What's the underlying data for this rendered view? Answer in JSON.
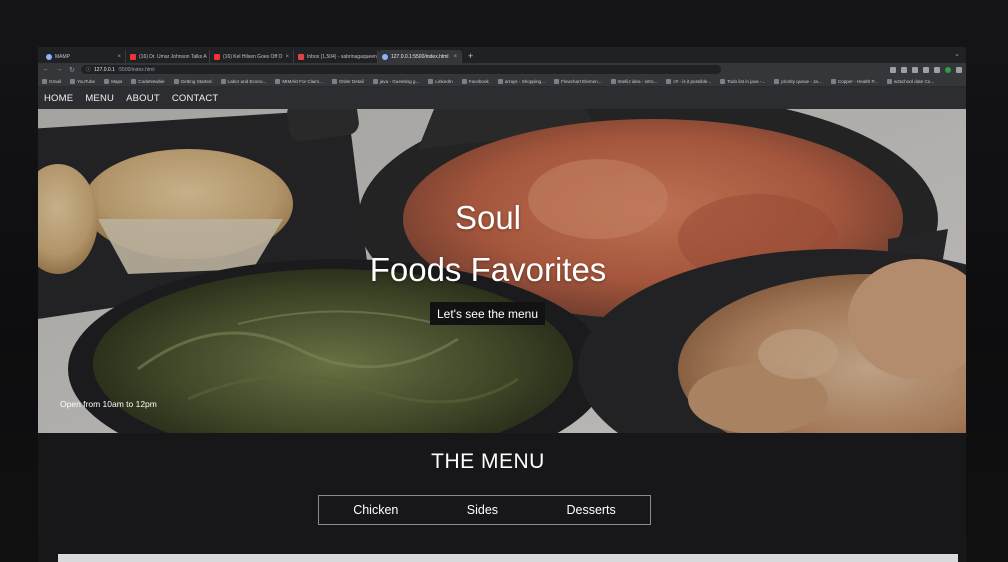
{
  "browser": {
    "tabs": [
      {
        "label": "MAMP",
        "icon": "mamp-icon",
        "active": false
      },
      {
        "label": "(16) Dr. Umar Johnson Talks A",
        "icon": "youtube-icon",
        "active": false
      },
      {
        "label": "(16) Kel Hilsen Goes Off O",
        "icon": "youtube-icon",
        "active": false
      },
      {
        "label": "Inbox (1,504) - sabrinagaqueen",
        "icon": "gmail-icon",
        "active": false
      },
      {
        "label": "127.0.0.1:5500/index.html",
        "icon": "page-icon",
        "active": true
      }
    ],
    "new_tab": "+",
    "url_host": "127.0.0.1",
    "url_path": ":5500/index.html",
    "bookmarks": [
      "Gmail",
      "YouTube",
      "Maps",
      "CodeNewbie",
      "Getting Started",
      "Labor and Econo...",
      "MIMAkt For Claim...",
      "Order Detail",
      "java - Guessing g...",
      "LinkedIn",
      "Facebook",
      "arrays - Shopping...",
      "Flowchart Elemen...",
      "IntelliJ idea - intro...",
      "c# - is it possible...",
      "Todo list in java -...",
      "priority queue - Ja...",
      "Copper - Health P...",
      "w3school date Co..."
    ]
  },
  "nav": {
    "home": "HOME",
    "menu": "MENU",
    "about": "ABOUT",
    "contact": "CONTACT"
  },
  "hero": {
    "title_line1": "Soul",
    "title_line2": "Foods Favorites",
    "cta": "Let's see the menu",
    "hours": "Open from 10am to 12pm"
  },
  "menu": {
    "title": "THE MENU",
    "tabs": [
      "Chicken",
      "Sides",
      "Desserts"
    ]
  },
  "colors": {
    "nav_bg": "#2c2d30",
    "section_bg": "#171719",
    "cta_bg": "#121212",
    "text": "#ffffff"
  }
}
